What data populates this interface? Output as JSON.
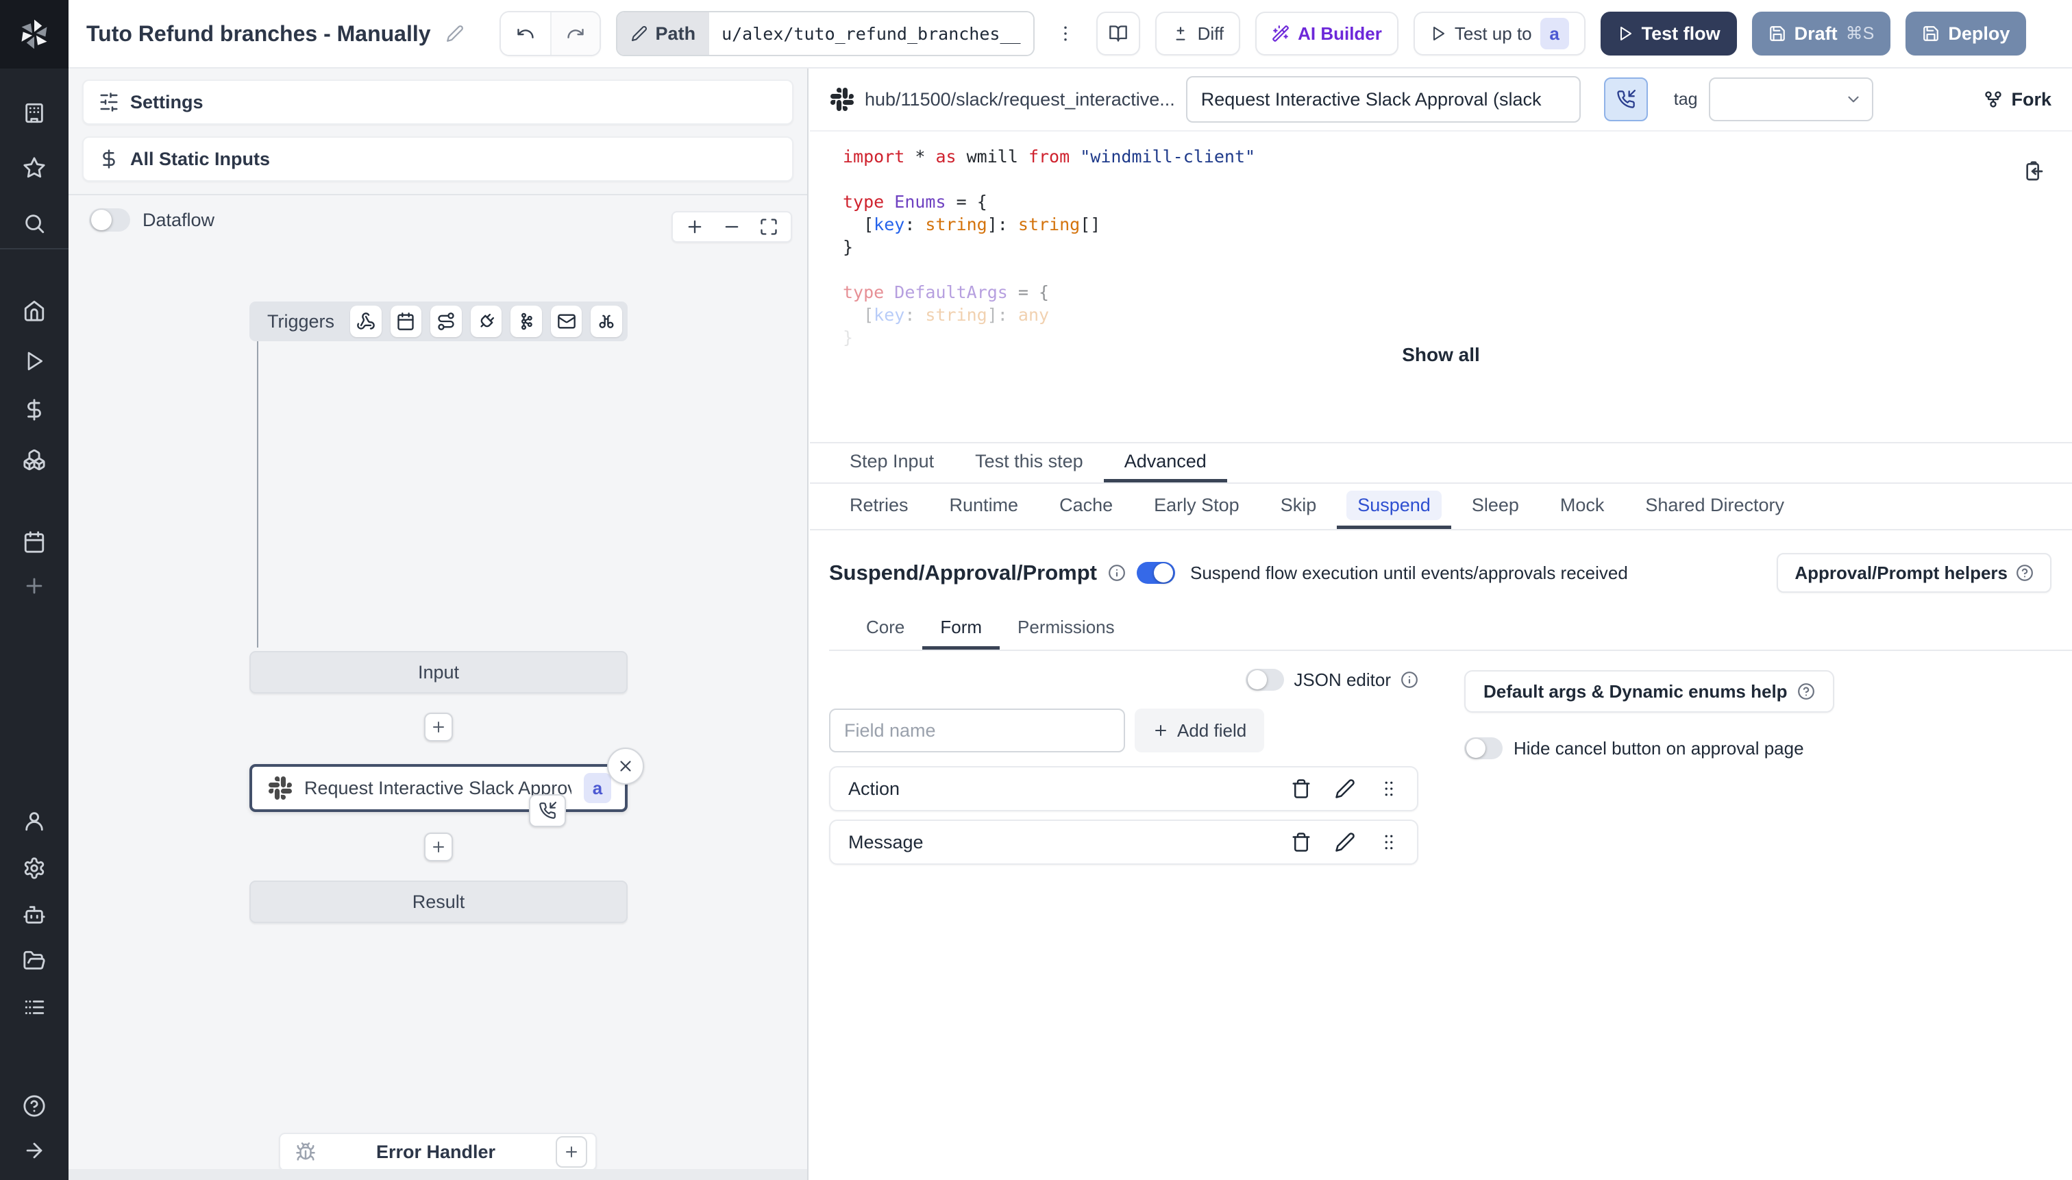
{
  "topbar": {
    "title": "Tuto Refund branches - Manually",
    "path_label": "Path",
    "path_value": "u/alex/tuto_refund_branches__",
    "diff_label": "Diff",
    "ai_builder_label": "AI Builder",
    "test_up_to_label": "Test up to",
    "test_up_to_badge": "a",
    "test_flow_label": "Test flow",
    "draft_label": "Draft",
    "draft_shortcut": "⌘S",
    "deploy_label": "Deploy"
  },
  "sidebar": {
    "icon_names_top": [
      "workspace",
      "favorites",
      "search"
    ],
    "icon_names_mid": [
      "home",
      "runs",
      "variables",
      "resources",
      "schedules",
      "create"
    ],
    "icon_names_lower": [
      "user",
      "settings",
      "workers",
      "folders",
      "apps-list"
    ],
    "icon_names_bottom": [
      "help",
      "expand"
    ]
  },
  "left_panel": {
    "settings_label": "Settings",
    "static_inputs_label": "All Static Inputs",
    "dataflow_label": "Dataflow",
    "graph": {
      "triggers_label": "Triggers",
      "trigger_icon_names": [
        "webhook",
        "schedule",
        "http-route",
        "websocket",
        "kafka",
        "email",
        "scheduled-poll"
      ],
      "input_label": "Input",
      "step_label": "Request Interactive Slack Approval (...",
      "step_badge": "a",
      "result_label": "Result",
      "error_handler_label": "Error Handler"
    }
  },
  "right_panel": {
    "header": {
      "hub_path": "hub/11500/slack/request_interactive...",
      "summary_value": "Request Interactive Slack Approval (slack",
      "tag_label": "tag",
      "fork_label": "Fork"
    },
    "code": {
      "show_all_label": "Show all",
      "lines": [
        {
          "tokens": [
            {
              "c": "k",
              "v": "import"
            },
            {
              "c": "p",
              "v": " * "
            },
            {
              "c": "k",
              "v": "as"
            },
            {
              "c": "p",
              "v": " wmill "
            },
            {
              "c": "k",
              "v": "from"
            },
            {
              "c": "p",
              "v": " "
            },
            {
              "c": "s",
              "v": "\"windmill-client\""
            }
          ]
        },
        {
          "tokens": []
        },
        {
          "tokens": [
            {
              "c": "k",
              "v": "type"
            },
            {
              "c": "p",
              "v": " "
            },
            {
              "c": "t",
              "v": "Enums"
            },
            {
              "c": "p",
              "v": " = {"
            }
          ]
        },
        {
          "tokens": [
            {
              "c": "p",
              "v": "  ["
            },
            {
              "c": "v",
              "v": "key"
            },
            {
              "c": "p",
              "v": ": "
            },
            {
              "c": "o",
              "v": "string"
            },
            {
              "c": "p",
              "v": "]: "
            },
            {
              "c": "o",
              "v": "string"
            },
            {
              "c": "p",
              "v": "[]"
            }
          ]
        },
        {
          "tokens": [
            {
              "c": "p",
              "v": "}"
            }
          ]
        },
        {
          "tokens": []
        },
        {
          "dim": 1,
          "tokens": [
            {
              "c": "k",
              "v": "type"
            },
            {
              "c": "p",
              "v": " "
            },
            {
              "c": "t",
              "v": "DefaultArgs"
            },
            {
              "c": "p",
              "v": " = {"
            }
          ]
        },
        {
          "dim": 2,
          "tokens": [
            {
              "c": "p",
              "v": "  ["
            },
            {
              "c": "v",
              "v": "key"
            },
            {
              "c": "p",
              "v": ": "
            },
            {
              "c": "o",
              "v": "string"
            },
            {
              "c": "p",
              "v": "]: "
            },
            {
              "c": "o",
              "v": "any"
            }
          ]
        },
        {
          "dim": 3,
          "tokens": [
            {
              "c": "p",
              "v": "}"
            }
          ]
        }
      ]
    },
    "tabs_main": {
      "items": [
        "Step Input",
        "Test this step",
        "Advanced"
      ],
      "selected": "Advanced"
    },
    "tabs_advanced": {
      "items": [
        "Retries",
        "Runtime",
        "Cache",
        "Early Stop",
        "Skip",
        "Suspend",
        "Sleep",
        "Mock",
        "Shared Directory"
      ],
      "selected": "Suspend"
    },
    "suspend": {
      "title": "Suspend/Approval/Prompt",
      "toggle_text": "Suspend flow execution until events/approvals received",
      "toggle_on": true,
      "helpers_button": "Approval/Prompt helpers",
      "tabs": {
        "items": [
          "Core",
          "Form",
          "Permissions"
        ],
        "selected": "Form"
      },
      "json_editor_label": "JSON editor",
      "json_editor_on": false,
      "field_name_placeholder": "Field name",
      "add_field_label": "Add field",
      "default_args_button": "Default args & Dynamic enums help",
      "hide_cancel_label": "Hide cancel button on approval page",
      "hide_cancel_on": false,
      "fields": [
        "Action",
        "Message"
      ]
    }
  },
  "colors": {
    "accent_blue": "#3569e8",
    "suspend_tab_blue": "#2e4fd0",
    "suspend_tab_bg": "#eef1fb",
    "test_flow_bg": "#303b59",
    "draft_deploy_bg": "#7289ab",
    "ai_builder_purple": "#6d28d9",
    "badge_bg": "#e1e5fa",
    "badge_text": "#4c59d2",
    "sidebar_bg": "#21252c",
    "panel_bg": "#f4f5f7",
    "selected_node_border": "#43506a"
  }
}
